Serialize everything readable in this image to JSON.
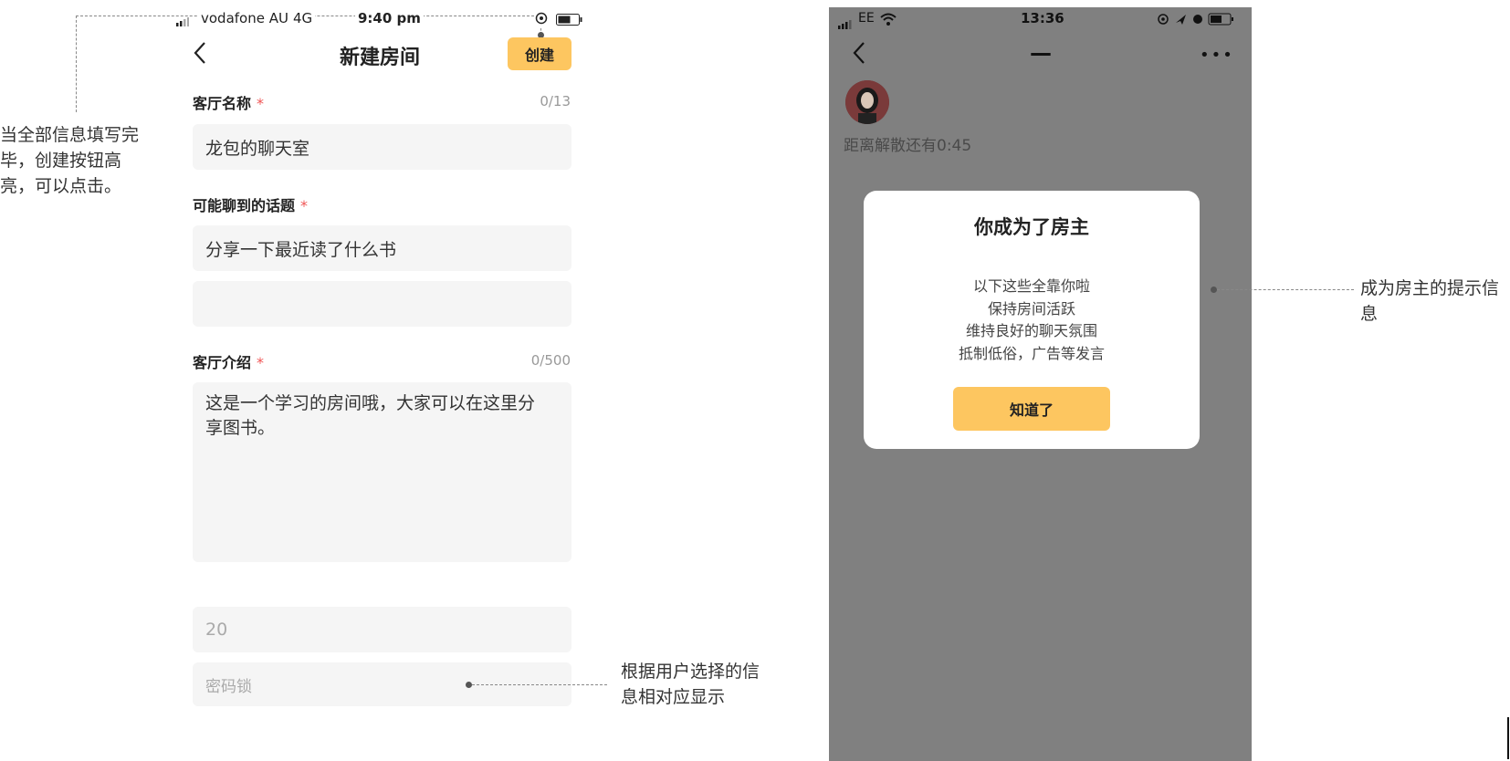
{
  "left_phone": {
    "status_bar": {
      "carrier": "vodafone AU",
      "network": "4G",
      "time": "9:40 pm"
    },
    "nav": {
      "title": "新建房间",
      "create_label": "创建"
    },
    "form": {
      "name_label": "客厅名称",
      "name_counter": "0/13",
      "name_value": "龙包的聊天室",
      "topic_label": "可能聊到的话题",
      "topic_value": "分享一下最近读了什么书",
      "topic_value_2": "",
      "intro_label": "客厅介绍",
      "intro_counter": "0/500",
      "intro_value": "这是一个学习的房间哦，大家可以在这里分享图书。",
      "capacity_value": "20",
      "password_placeholder": "密码锁",
      "required_mark": "*"
    }
  },
  "right_phone": {
    "status_bar": {
      "carrier": "EE",
      "time": "13:36"
    },
    "nav": {
      "title": "—",
      "more_label": "•••"
    },
    "countdown": "距离解散还有0:45",
    "modal": {
      "title": "你成为了房主",
      "lines": [
        "以下这些全靠你啦",
        "保持房间活跃",
        "维持良好的聊天氛围",
        "抵制低俗，广告等发言"
      ],
      "ok_label": "知道了"
    }
  },
  "annotations": {
    "create_note": "当全部信息填写完毕，创建按钮高亮，可以点击。",
    "password_note": "根据用户选择的信息相对应显示",
    "owner_note": "成为房主的提示信息"
  },
  "colors": {
    "accent": "#FDC660",
    "required": "#F05454",
    "overlay": "#808080"
  }
}
